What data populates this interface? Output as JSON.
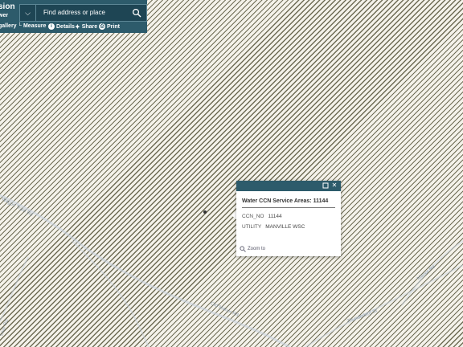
{
  "app": {
    "title_fragment": "sion",
    "subtitle_fragment": "wer"
  },
  "search": {
    "placeholder": "Find address or place",
    "chevron_icon": "chevron-down-icon",
    "search_icon": "search-icon"
  },
  "toolbar": {
    "items": [
      {
        "label": "gallery",
        "icon": "grid-icon"
      },
      {
        "label": "Measure",
        "icon": "ruler-icon"
      },
      {
        "label": "Details",
        "icon": "info-icon"
      },
      {
        "label": "Share",
        "icon": "share-icon"
      },
      {
        "label": "Print",
        "icon": "print-icon"
      }
    ]
  },
  "popup": {
    "title": "Water CCN Service Areas: 11144",
    "fields": [
      {
        "name": "CCN_NO",
        "value": "11144"
      },
      {
        "name": "UTILITY",
        "value": "MANVILLE WSC"
      }
    ],
    "zoom_label": "Zoom to"
  },
  "map": {
    "road_labels": [
      "Wagon Train Rd",
      "Old Manor Rd",
      "Thunderbird St",
      "Lear Rd",
      "Bay Arrow Dr",
      "Manor Rd"
    ]
  },
  "colors": {
    "header": "#2d5b6b",
    "hatch": "#6e6c55",
    "map_bg": "#f4f2ea"
  }
}
